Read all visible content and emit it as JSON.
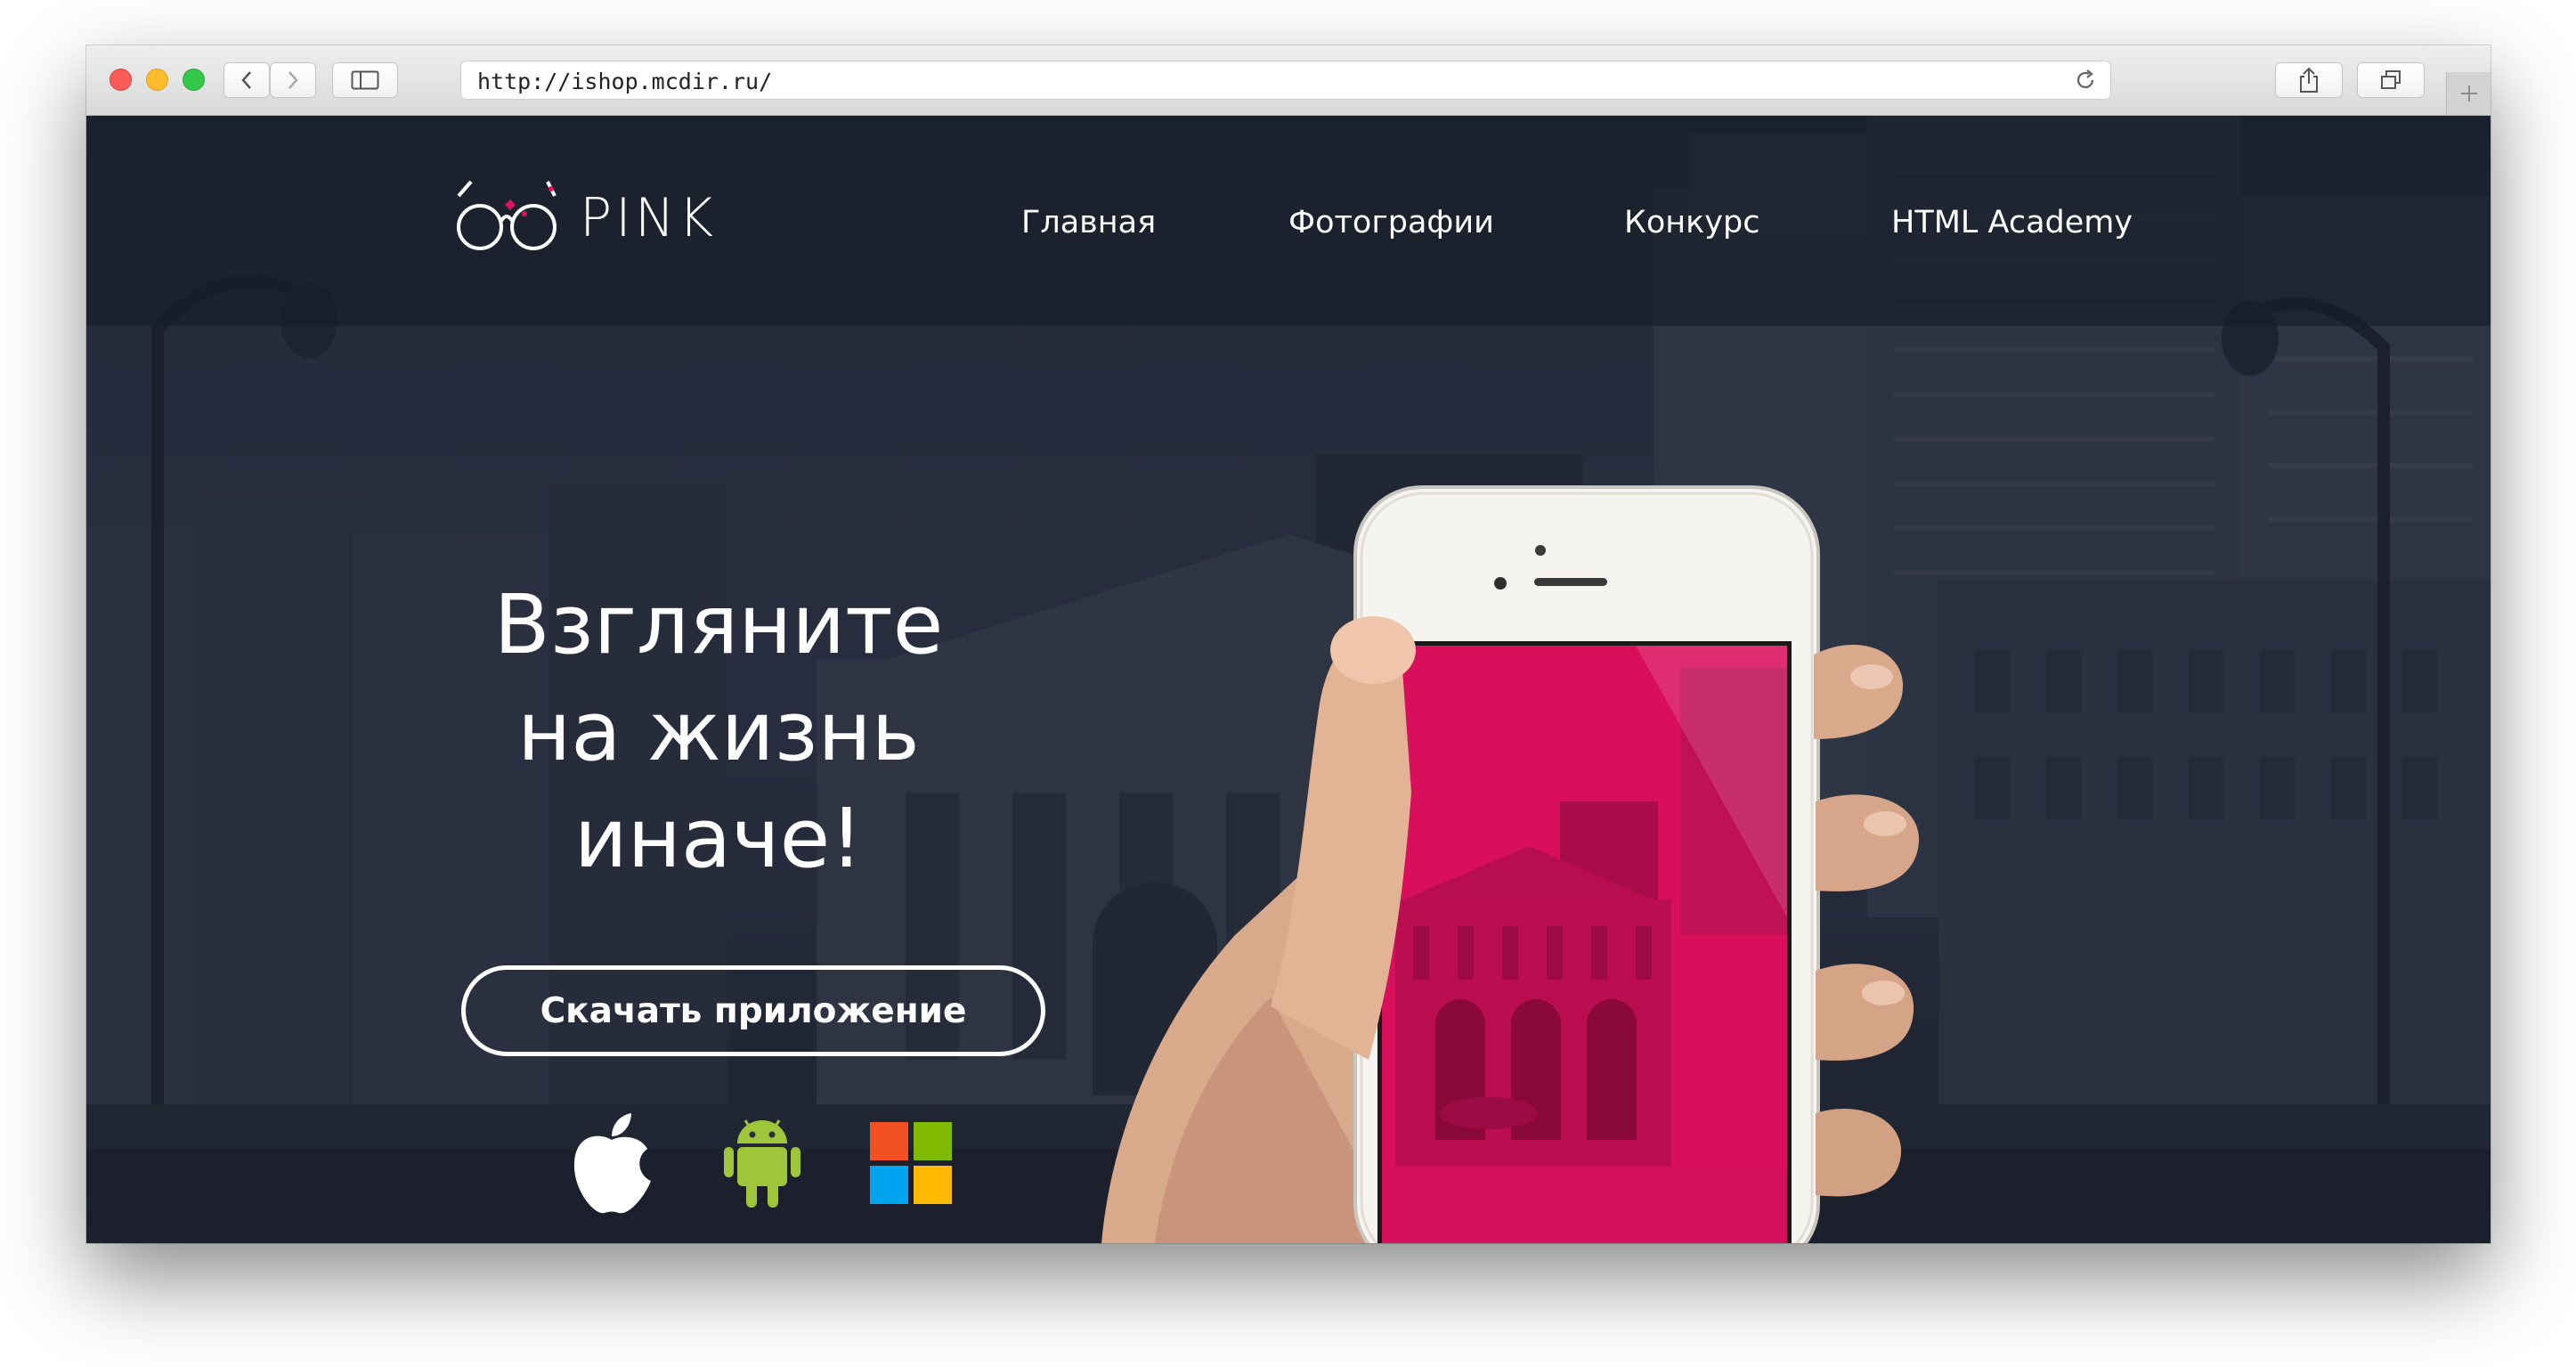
{
  "browser": {
    "url": "http://ishop.mcdir.ru/"
  },
  "site": {
    "logo_text": "PINK",
    "nav": {
      "home": "Главная",
      "photos": "Фотографии",
      "contest": "Конкурс",
      "academy": "HTML Academy"
    },
    "hero": {
      "headline_lines": [
        "Взгляните",
        "на жизнь",
        "иначе!"
      ],
      "download_label": "Скачать приложение"
    },
    "stores": [
      "apple-icon",
      "android-icon",
      "windows-icon"
    ],
    "colors": {
      "brand_pink": "#e0115f",
      "header_band": "#181d28",
      "windows_red": "#f25022",
      "windows_green": "#7fba00",
      "windows_blue": "#00a4ef",
      "windows_yellow": "#ffb900",
      "android_green": "#9fc63b"
    }
  }
}
